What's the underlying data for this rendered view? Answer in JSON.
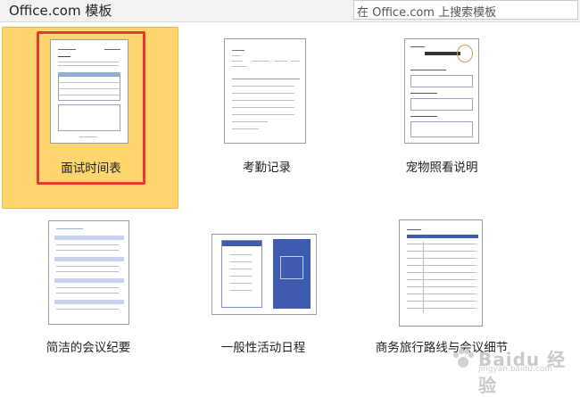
{
  "header": {
    "title": "Office.com 模板",
    "search_placeholder": "在 Office.com 上搜索模板"
  },
  "templates": [
    {
      "label": "面试时间表",
      "selected": true
    },
    {
      "label": "考勤记录",
      "selected": false
    },
    {
      "label": "宠物照看说明",
      "selected": false
    },
    {
      "label": "简洁的会议纪要",
      "selected": false
    },
    {
      "label": "一般性活动日程",
      "selected": false
    },
    {
      "label": "商务旅行路线与会议细节",
      "selected": false
    }
  ],
  "watermark": {
    "text": "Baidu 经验",
    "sub": "jingyan.baidu.com"
  },
  "colors": {
    "selected_bg": "#ffd56e",
    "highlight": "#e53935",
    "accent_blue": "#3f5bb0"
  }
}
